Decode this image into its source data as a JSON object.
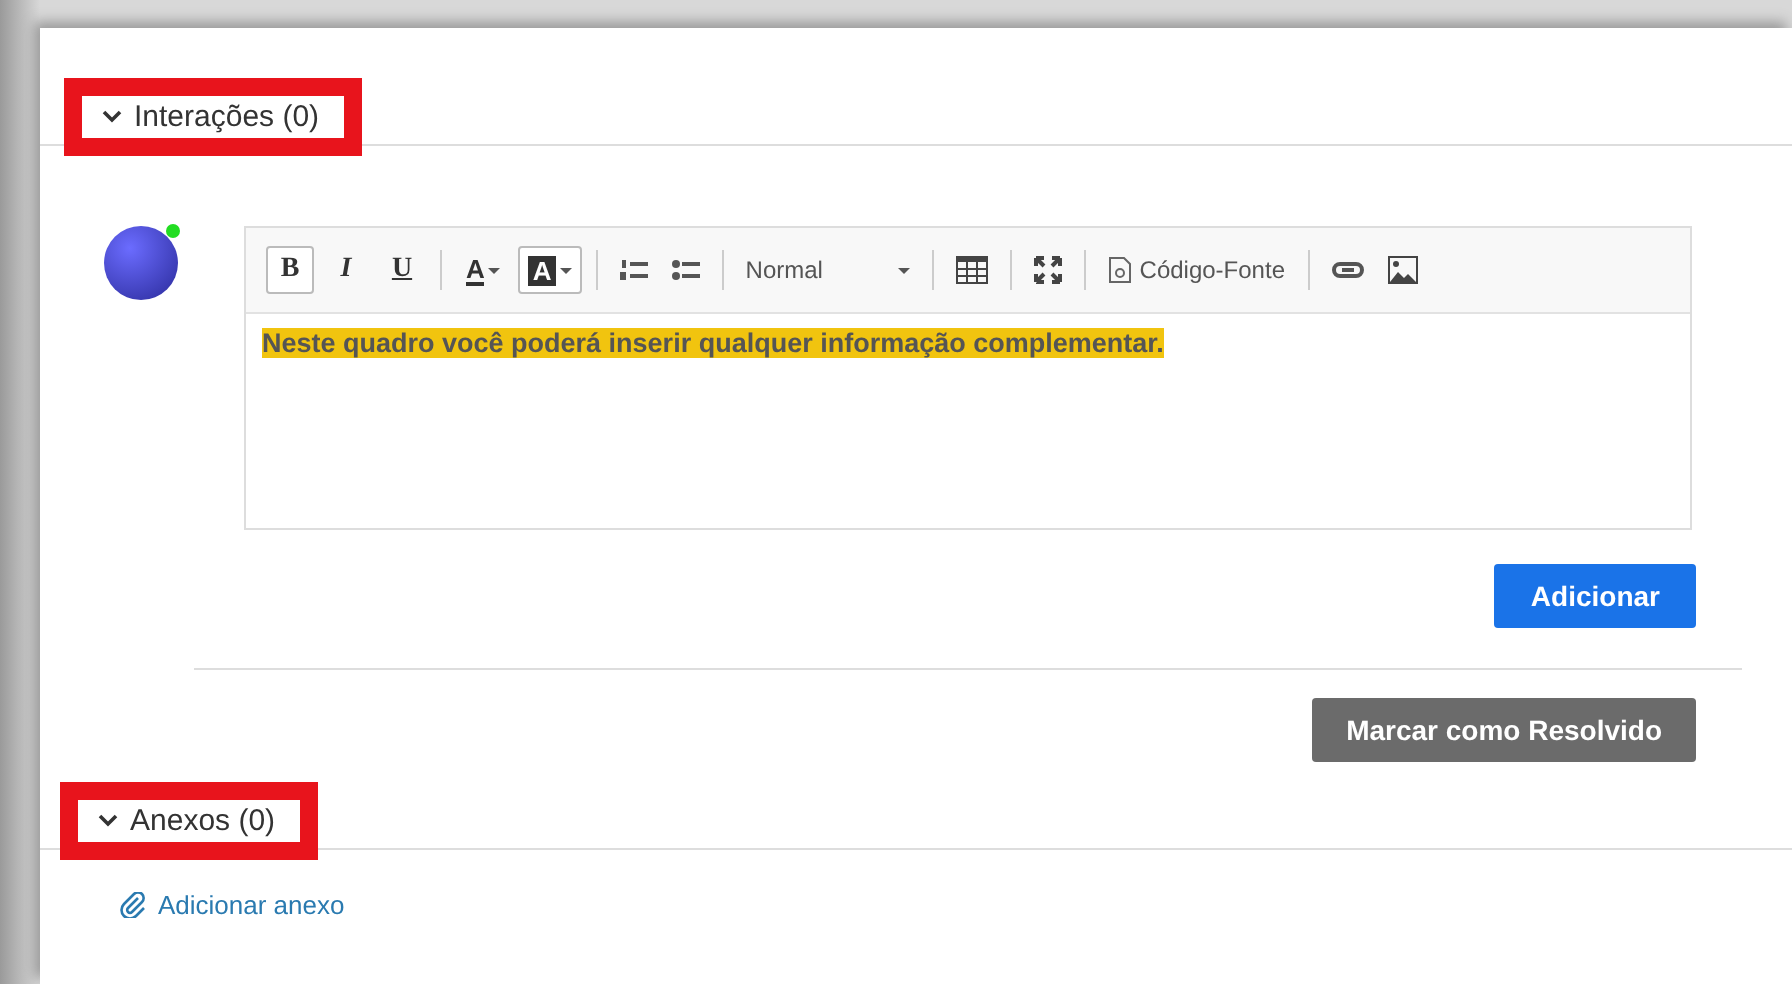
{
  "interactions": {
    "title": "Interações (0)",
    "expanded": true
  },
  "avatar": {
    "online": true
  },
  "editor": {
    "toolbar": {
      "format_buttons": [
        {
          "label": "B",
          "selected": true
        },
        {
          "label": "I",
          "selected": false
        },
        {
          "label": "U",
          "selected": false
        }
      ],
      "color_buttons": [
        {
          "label": "A",
          "selected": false
        },
        {
          "label": "A",
          "selected": true
        }
      ],
      "style_select": {
        "value": "Normal"
      },
      "source_button": {
        "label": "Código-Fonte"
      }
    },
    "content": "Neste quadro você poderá inserir qualquer informação complementar."
  },
  "add_button": "Adicionar",
  "resolve_button": "Marcar como Resolvido",
  "attachments": {
    "title": "Anexos (0)",
    "expanded": true,
    "add_link": "Adicionar anexo"
  }
}
